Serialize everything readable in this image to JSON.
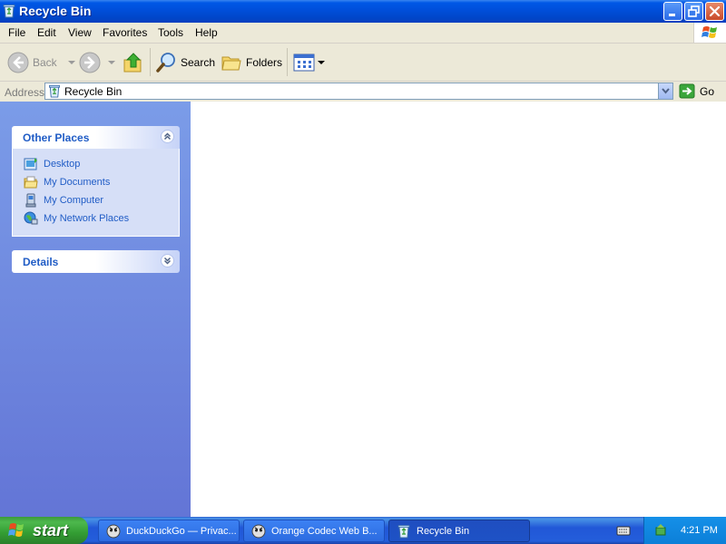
{
  "window": {
    "title": "Recycle Bin",
    "icons": {
      "title": "recycle-bin-icon",
      "minimize": "minimize-icon",
      "maximize": "restore-icon",
      "close": "close-icon"
    }
  },
  "menu": {
    "items": [
      "File",
      "Edit",
      "View",
      "Favorites",
      "Tools",
      "Help"
    ]
  },
  "toolbar": {
    "back_label": "Back",
    "search_label": "Search",
    "folders_label": "Folders"
  },
  "address": {
    "label": "Address",
    "value": "Recycle Bin",
    "go_label": "Go"
  },
  "taskpane": {
    "other_places": {
      "title": "Other Places",
      "items": [
        {
          "label": "Desktop",
          "icon": "desktop-icon"
        },
        {
          "label": "My Documents",
          "icon": "folder-documents-icon"
        },
        {
          "label": "My Computer",
          "icon": "computer-icon"
        },
        {
          "label": "My Network Places",
          "icon": "network-icon"
        }
      ]
    },
    "details": {
      "title": "Details"
    }
  },
  "taskbar": {
    "start_label": "start",
    "tasks": [
      {
        "label": "DuckDuckGo — Privac...",
        "icon": "duckduckgo-icon",
        "active": false
      },
      {
        "label": "Orange Codec Web B...",
        "icon": "browser-icon",
        "active": false
      },
      {
        "label": "Recycle Bin",
        "icon": "recycle-bin-icon",
        "active": true
      }
    ],
    "clock": "4:21 PM"
  },
  "colors": {
    "titlebar": "#0050dc",
    "taskpane": "#6f89dd",
    "link": "#215dc6",
    "taskbar": "#245edb",
    "start": "#339d33"
  }
}
